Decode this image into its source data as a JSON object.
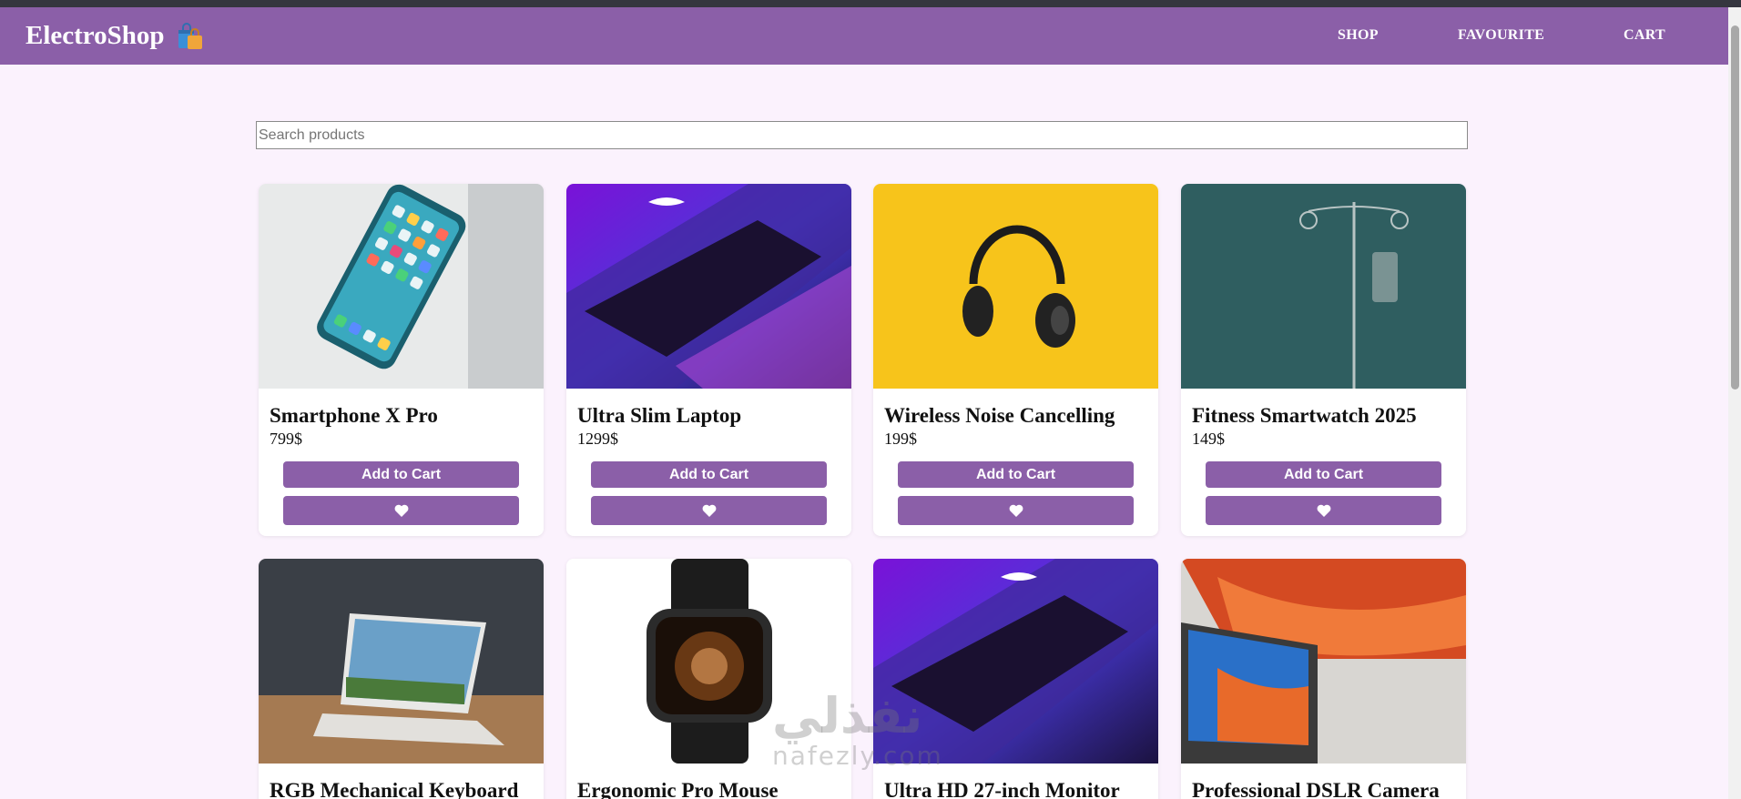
{
  "navbar": {
    "brand": "ElectroShop",
    "brand_icon": "shopping-bags-icon",
    "links": [
      "SHOP",
      "FAVOURITE",
      "CART"
    ],
    "background": "#8b5fa8"
  },
  "search": {
    "placeholder": "Search products",
    "value": ""
  },
  "products": [
    {
      "name": "Smartphone X Pro",
      "price": "799$",
      "image": "smartphone-image"
    },
    {
      "name": "Ultra Slim Laptop",
      "price": "1299$",
      "image": "laptop-image"
    },
    {
      "name": "Wireless Noise Cancelling",
      "price": "199$",
      "image": "headphones-image"
    },
    {
      "name": "Fitness Smartwatch 2025",
      "price": "149$",
      "image": "iv-stand-image"
    },
    {
      "name": "RGB Mechanical Keyboard",
      "image": "laptop-desk-image"
    },
    {
      "name": "Ergonomic Pro Mouse",
      "image": "smartwatch-image"
    },
    {
      "name": "Ultra HD 27-inch Monitor",
      "image": "laptop-image"
    },
    {
      "name": "Professional DSLR Camera",
      "image": "monitor-desk-image"
    }
  ],
  "card_buttons": {
    "add_to_cart": "Add to Cart",
    "favourite_icon": "heart-icon"
  },
  "watermark": {
    "arabic": "نفذلي",
    "latin": "nafezly.com"
  },
  "colors": {
    "accent": "#8b5fa8",
    "page_bg": "#fbf2fd"
  }
}
